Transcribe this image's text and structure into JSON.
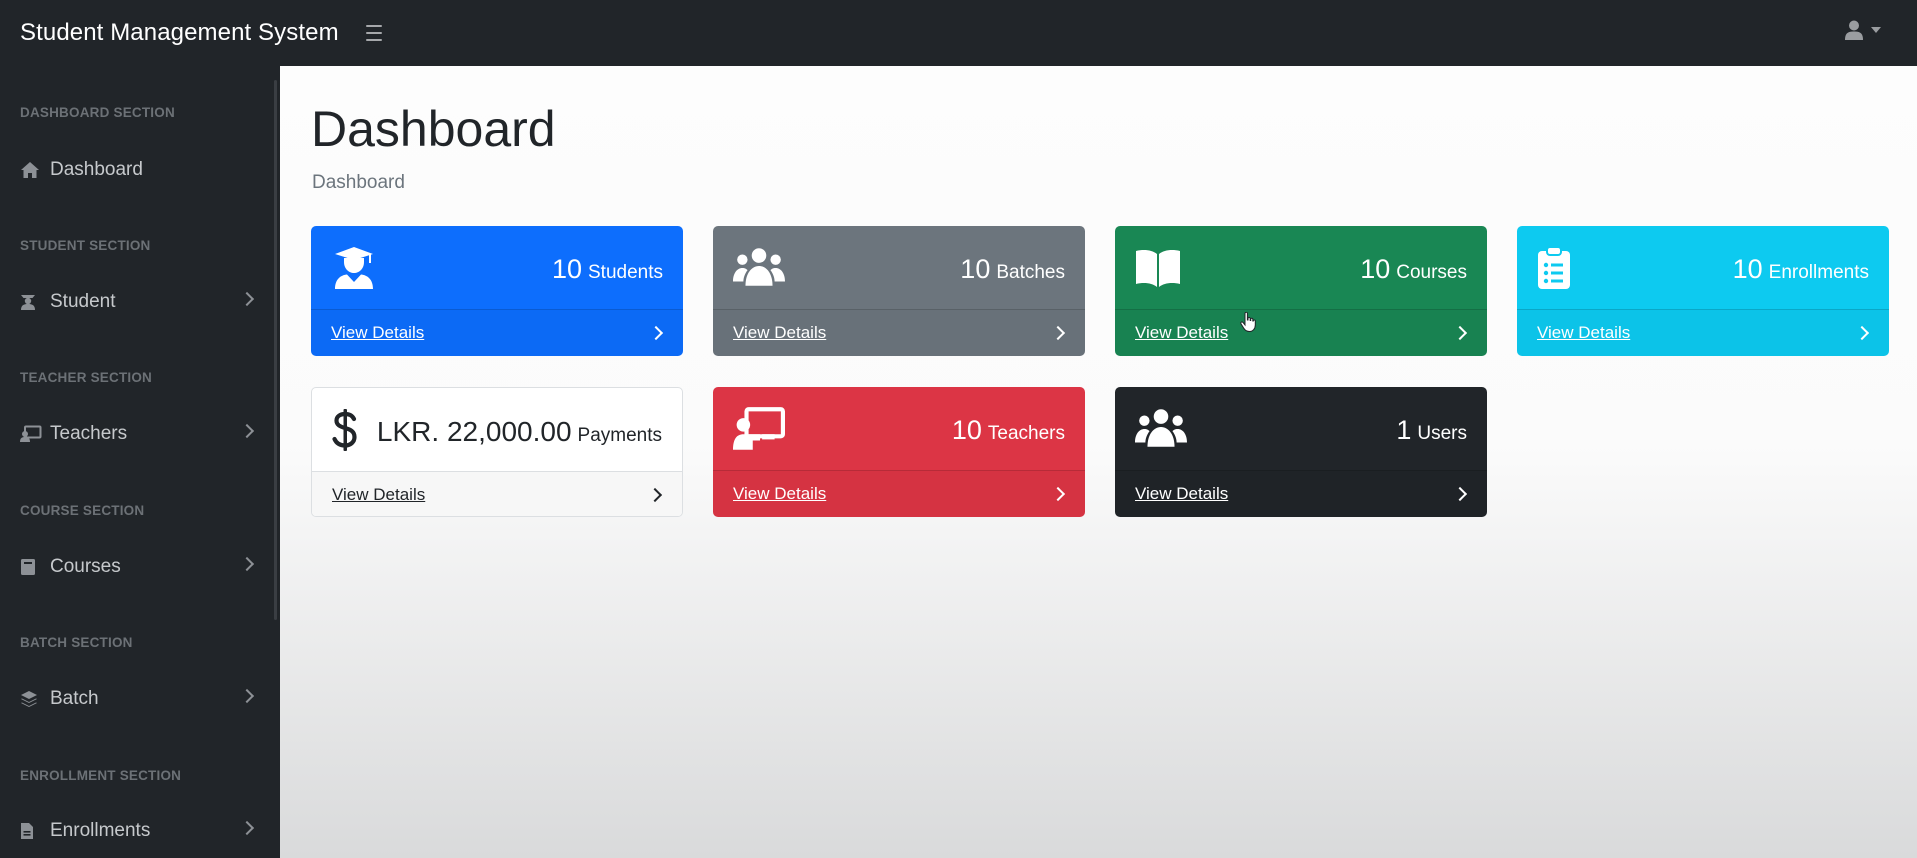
{
  "app": {
    "title": "Student Management System",
    "menu_icon": "hamburger-icon",
    "user_icon": "user-icon"
  },
  "sidebar": {
    "sections": [
      {
        "heading": "DASHBOARD SECTION",
        "item": {
          "label": "Dashboard",
          "icon": "home-icon",
          "has_submenu": false
        }
      },
      {
        "heading": "STUDENT SECTION",
        "item": {
          "label": "Student",
          "icon": "graduate-icon",
          "has_submenu": true
        }
      },
      {
        "heading": "TEACHER SECTION",
        "item": {
          "label": "Teachers",
          "icon": "chalkboard-teacher-icon",
          "has_submenu": true
        }
      },
      {
        "heading": "COURSE SECTION",
        "item": {
          "label": "Courses",
          "icon": "book-icon",
          "has_submenu": true
        }
      },
      {
        "heading": "BATCH SECTION",
        "item": {
          "label": "Batch",
          "icon": "layers-icon",
          "has_submenu": true
        }
      },
      {
        "heading": "ENROLLMENT SECTION",
        "item": {
          "label": "Enrollments",
          "icon": "file-icon",
          "has_submenu": true
        }
      }
    ]
  },
  "main": {
    "title": "Dashboard",
    "breadcrumb": "Dashboard",
    "cards": [
      {
        "value": "10",
        "label": "Students",
        "link": "View Details",
        "icon": "user-graduate-icon",
        "color": "#0d6efd"
      },
      {
        "value": "10",
        "label": "Batches",
        "link": "View Details",
        "icon": "users-icon",
        "color": "#6c757d"
      },
      {
        "value": "10",
        "label": "Courses",
        "link": "View Details",
        "icon": "book-open-icon",
        "color": "#198754"
      },
      {
        "value": "10",
        "label": "Enrollments",
        "link": "View Details",
        "icon": "clipboard-list-icon",
        "color": "#0dcaf0"
      },
      {
        "value": "LKR. 22,000.00",
        "label": "Payments",
        "link": "View Details",
        "icon": "dollar-icon",
        "color": "#ffffff"
      },
      {
        "value": "10",
        "label": "Teachers",
        "link": "View Details",
        "icon": "chalkboard-teacher-icon",
        "color": "#dc3545"
      },
      {
        "value": "1",
        "label": "Users",
        "link": "View Details",
        "icon": "users-icon",
        "color": "#212529"
      }
    ]
  }
}
